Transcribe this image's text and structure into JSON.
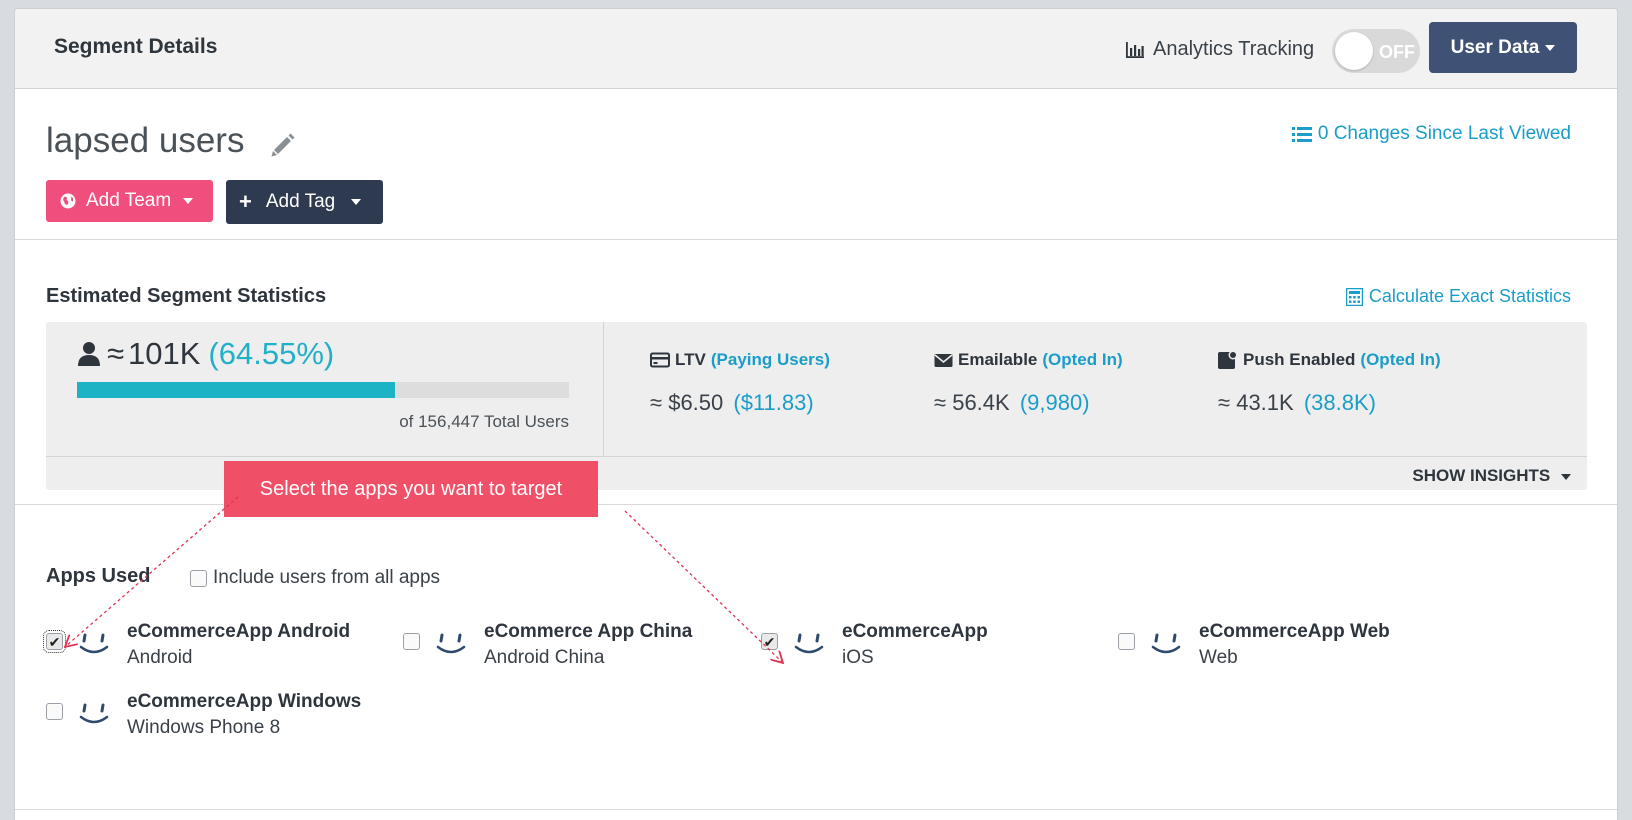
{
  "header": {
    "title": "Segment Details",
    "analytics_label": "Analytics Tracking",
    "toggle_state": "OFF",
    "user_data_label": "User Data"
  },
  "segment": {
    "name": "lapsed users",
    "changes_link": "0 Changes Since Last Viewed",
    "add_team_label": "Add Team",
    "add_tag_label": "Add Tag"
  },
  "stats": {
    "title": "Estimated Segment Statistics",
    "calc_link": "Calculate Exact Statistics",
    "users_approx": "≈",
    "users_count": "101K",
    "users_pct": "(64.55%)",
    "users_fraction": 0.6455,
    "total": "of 156,447 Total Users",
    "metrics": [
      {
        "label": "LTV",
        "sub": "(Paying Users)",
        "approx": "≈",
        "value": "$6.50",
        "alt": "($11.83)"
      },
      {
        "label": "Emailable",
        "sub": "(Opted In)",
        "approx": "≈",
        "value": "56.4K",
        "alt": "(9,980)"
      },
      {
        "label": "Push Enabled",
        "sub": "(Opted In)",
        "approx": "≈",
        "value": "43.1K",
        "alt": "(38.8K)"
      }
    ],
    "insights_label": "SHOW INSIGHTS"
  },
  "tooltip": "Select the apps you want to target",
  "apps": {
    "title": "Apps Used",
    "include_all_label": "Include users from all apps",
    "items": [
      {
        "name": "eCommerceApp Android",
        "platform": "Android",
        "checked": true
      },
      {
        "name": "eCommerce App China",
        "platform": "Android China",
        "checked": false
      },
      {
        "name": "eCommerceApp",
        "platform": "iOS",
        "checked": true
      },
      {
        "name": "eCommerceApp Web",
        "platform": "Web",
        "checked": false
      },
      {
        "name": "eCommerceApp Windows",
        "platform": "Windows Phone 8",
        "checked": false
      }
    ]
  },
  "colors": {
    "accent": "#1b9dc9",
    "progress": "#1db3c4",
    "team_button": "#f04e7c",
    "tag_button": "#2e3a4f",
    "user_data_button": "#3f5276",
    "tooltip": "#ef5068"
  }
}
